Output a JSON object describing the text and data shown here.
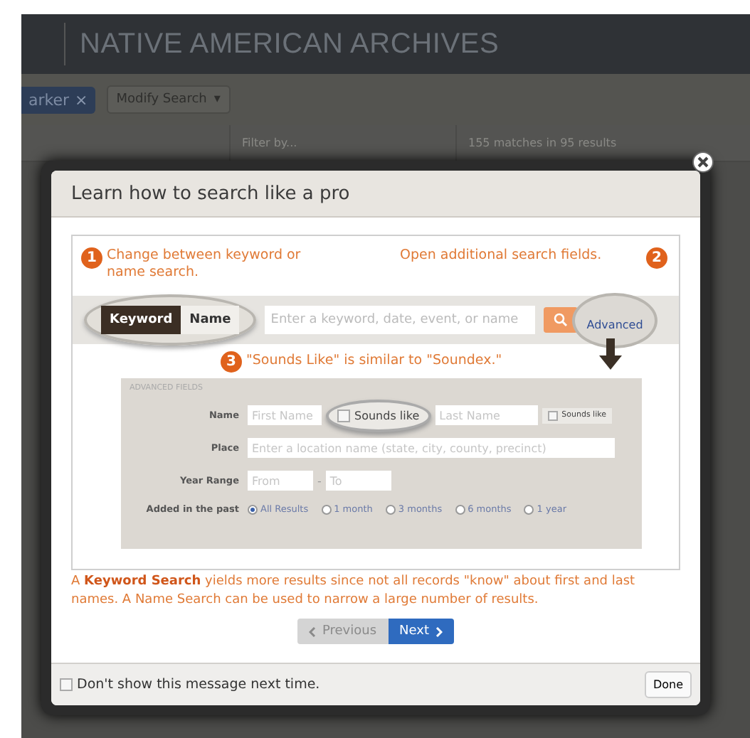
{
  "page_header": {
    "title": "NATIVE AMERICAN ARCHIVES"
  },
  "toolbar": {
    "tag": "arker",
    "tag_remove": "×",
    "modify_button": "Modify Search",
    "modify_caret": "▾"
  },
  "results_header": {
    "filter_placeholder": "Filter by...",
    "count": "155 matches in 95 results"
  },
  "modal": {
    "title": "Learn how to search like a pro",
    "tutorial": {
      "callouts": [
        {
          "number": "1",
          "text": "Change between keyword or name search."
        },
        {
          "number": "2",
          "text": "Open additional search fields."
        },
        {
          "number": "3",
          "text": "\"Sounds Like\" is similar to \"Soundex.\""
        }
      ],
      "search_bar": {
        "modes": [
          {
            "label": "Keyword",
            "selected": true
          },
          {
            "label": "Name",
            "selected": false
          }
        ],
        "placeholder": "Enter a keyword, date, event, or name",
        "advanced_link": "Advanced"
      },
      "advanced_fields": {
        "legend": "ADVANCED FIELDS",
        "name_label": "Name",
        "first_placeholder": "First Name",
        "last_placeholder": "Last Name",
        "sounds_like": [
          {
            "label": "Sounds like",
            "checked": false,
            "kind": "zoomed"
          },
          {
            "label": "Sounds like",
            "checked": false,
            "kind": "plain"
          }
        ],
        "place_label": "Place",
        "place_placeholder": "Enter a location name (state, city, county, precinct)",
        "year_label": "Year Range",
        "from_placeholder": "From",
        "dash": "-",
        "to_placeholder": "To",
        "added_label": "Added in the past",
        "ranges": [
          {
            "label": "All Results",
            "selected": true
          },
          {
            "label": "1 month",
            "selected": false
          },
          {
            "label": "3 months",
            "selected": false
          },
          {
            "label": "6 months",
            "selected": false
          },
          {
            "label": "1 year",
            "selected": false
          }
        ]
      }
    },
    "note": "A **Keyword Search** yields more results since not all records \"know\" about first and last names. A Name Search can be used to narrow a large number of results.",
    "pager": {
      "previous": {
        "label": "Previous",
        "disabled": true
      },
      "next": {
        "label": "Next",
        "disabled": false
      }
    },
    "footer": {
      "dont_show": {
        "label": "Don't show this message next time.",
        "checked": false
      },
      "done": "Done"
    }
  }
}
